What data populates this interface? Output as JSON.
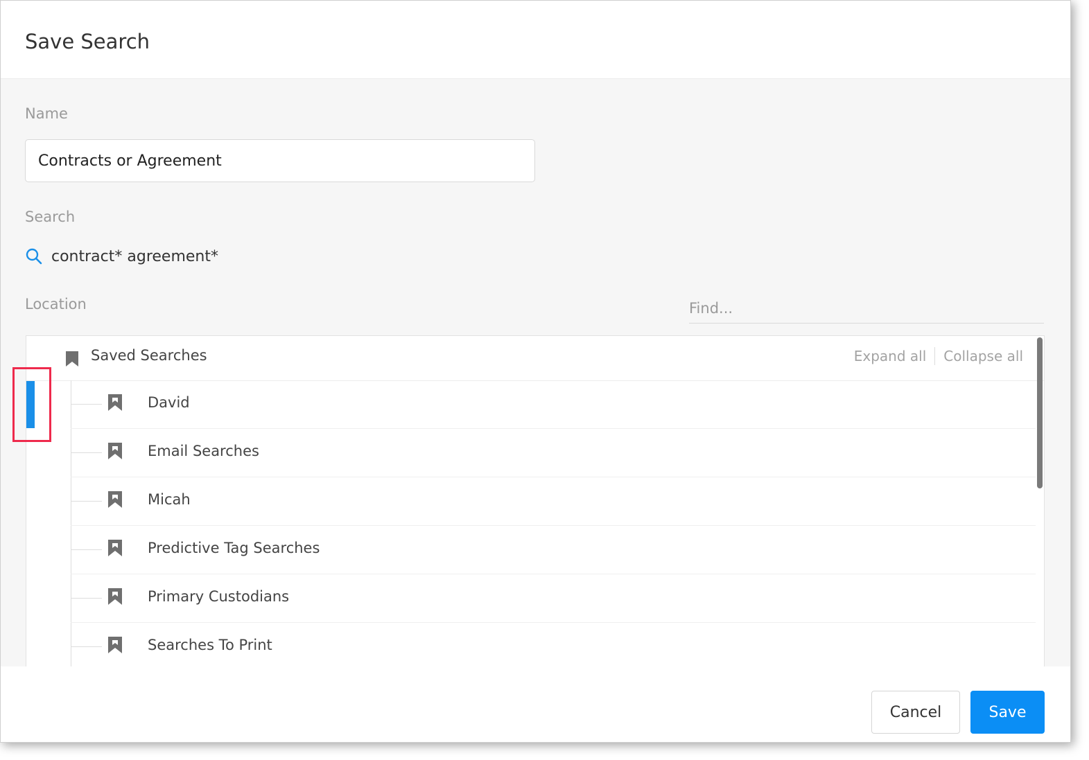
{
  "dialog": {
    "title": "Save Search"
  },
  "form": {
    "name_label": "Name",
    "name_value": "Contracts or Agreement",
    "search_label": "Search",
    "search_query": "contract* agreement*",
    "location_label": "Location",
    "find_placeholder": "Find..."
  },
  "tree": {
    "root_label": "Saved Searches",
    "expand_all": "Expand all",
    "collapse_all": "Collapse all",
    "items": [
      {
        "label": "David",
        "icon": "bookmark-icon"
      },
      {
        "label": "Email Searches",
        "icon": "bookmark-icon"
      },
      {
        "label": "Micah",
        "icon": "bookmark-icon"
      },
      {
        "label": "Predictive Tag Searches",
        "icon": "bookmark-icon"
      },
      {
        "label": "Primary Custodians",
        "icon": "bookmark-icon"
      },
      {
        "label": "Searches To Print",
        "icon": "bookmark-icon"
      }
    ]
  },
  "footer": {
    "cancel_label": "Cancel",
    "save_label": "Save"
  },
  "colors": {
    "primary": "#0b8ef5",
    "highlight_border": "#ee2a4c",
    "highlight_bar": "#1a8fe8"
  }
}
